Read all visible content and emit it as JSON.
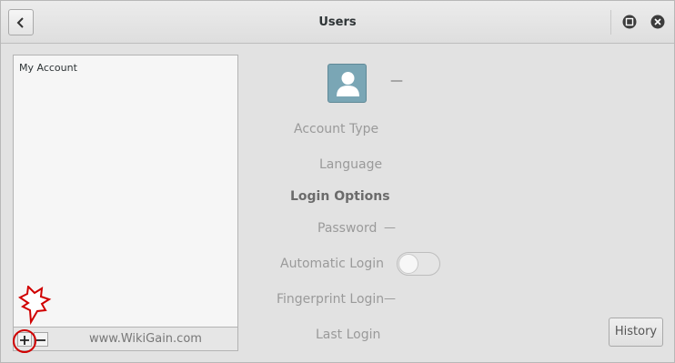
{
  "header": {
    "title": "Users",
    "back_icon": "chevron-left-icon",
    "restore_icon": "window-restore-icon",
    "close_icon": "window-close-icon"
  },
  "sidebar": {
    "items": [
      {
        "label": "My Account"
      }
    ],
    "add_icon": "plus-icon",
    "remove_icon": "minus-icon",
    "watermark": "www.WikiGain.com",
    "highlight_color": "#d00000"
  },
  "account": {
    "name": "—",
    "avatar_icon": "user-avatar-icon",
    "account_type_label": "Account Type",
    "language_label": "Language",
    "login_options_heading": "Login Options",
    "password_label": "Password",
    "password_value": "—",
    "automatic_login_label": "Automatic Login",
    "automatic_login_enabled": false,
    "fingerprint_label": "Fingerprint Login",
    "fingerprint_value": "—",
    "last_login_label": "Last Login",
    "history_label": "History"
  },
  "colors": {
    "avatar_bg": "#7aa6b5",
    "window_bg": "#e2e2e2"
  }
}
